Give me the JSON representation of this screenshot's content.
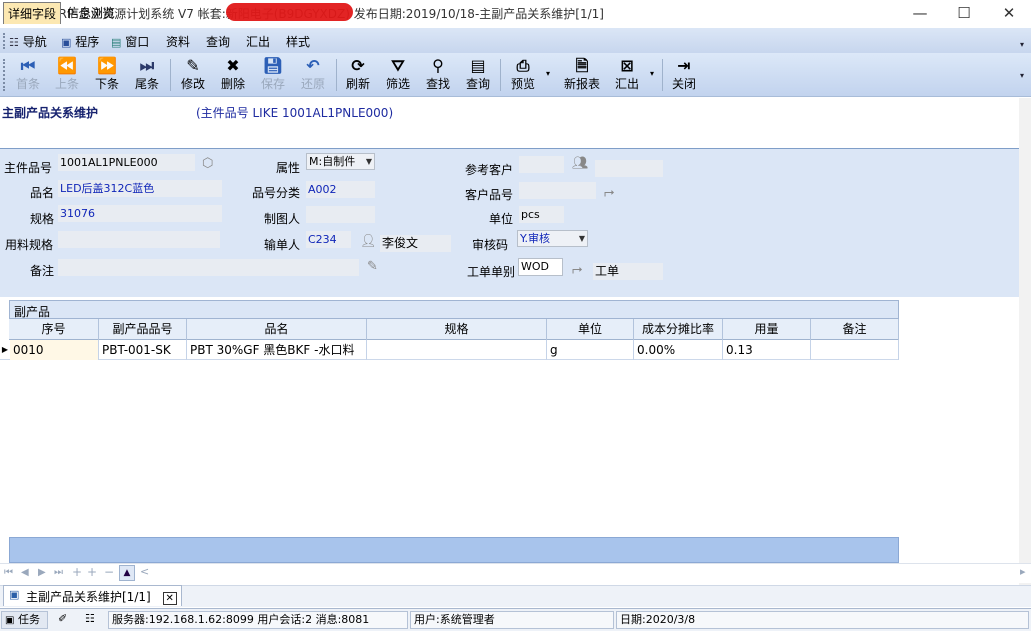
{
  "window": {
    "title": "蓝鲸ERP-企业资源计划系统 V7 帐套:新阳电子(B9DGYXDZ) 发布日期:2019/10/18-主副产品关系维护[1/1]",
    "controls": [
      "—",
      "☐",
      "✕"
    ]
  },
  "menu": {
    "items": [
      "导航",
      "程序",
      "窗口",
      "资料",
      "查询",
      "汇出",
      "样式"
    ]
  },
  "toolbar": {
    "first": "首条",
    "prev": "上条",
    "next": "下条",
    "last": "尾条",
    "edit": "修改",
    "delete": "删除",
    "save": "保存",
    "undo": "还原",
    "refresh": "刷新",
    "filter": "筛选",
    "find": "查找",
    "query": "查询",
    "preview": "预览",
    "new_report": "新报表",
    "export": "汇出",
    "close": "关闭"
  },
  "header": {
    "form_title": "主副产品关系维护",
    "filter": "(主件品号 LIKE 1001AL1PNLE000)"
  },
  "tabs": {
    "detail": "详细字段",
    "browse": "信息浏览"
  },
  "form": {
    "main_item_label": "主件品号",
    "main_item_value": "1001AL1PNLE000",
    "name_label": "品名",
    "name_value": "LED后盖312C蓝色",
    "spec_label": "规格",
    "spec_value": "31076",
    "material_spec_label": "用料规格",
    "material_spec_value": "",
    "remark_label": "备注",
    "remark_value": "",
    "attribute_label": "属性",
    "attribute_value": "M:自制件",
    "category_label": "品号分类",
    "category_value": "A002",
    "drawer_label": "制图人",
    "drawer_value": "",
    "input_by_label": "输单人",
    "input_by_code": "C234",
    "input_by_name": "李俊文",
    "ref_customer_label": "参考客户",
    "ref_customer_value": "",
    "ref_customer_name": "",
    "customer_item_label": "客户品号",
    "customer_item_value": "",
    "unit_label": "单位",
    "unit_value": "pcs",
    "audit_label": "审核码",
    "audit_value": "Y.审核",
    "worder_label": "工单单别",
    "worder_code": "WOD",
    "worder_name": "工单"
  },
  "grid": {
    "caption": "副产品",
    "columns": [
      "序号",
      "副产品品号",
      "品名",
      "规格",
      "单位",
      "成本分摊比率",
      "用量",
      "备注"
    ],
    "rows": [
      [
        "0010",
        "PBT-001-SK",
        "PBT 30%GF 黑色BKF -水口料",
        "",
        "g",
        "0.00%",
        "0.13",
        ""
      ]
    ]
  },
  "navbar": {
    "up": "▲",
    "chevron": "<"
  },
  "doctab": {
    "label": "主副产品关系维护[1/1]",
    "close": "✕"
  },
  "status": {
    "task": "任务",
    "server": "服务器:192.168.1.62:8099 用户会话:2 消息:8081",
    "user": "用户:系统管理者",
    "date": "日期:2020/3/8"
  },
  "colors": {
    "accent": "#16226f",
    "panel": "#dbe6f6",
    "field_text": "#1026b8",
    "active_tab": "#fce8b2"
  }
}
